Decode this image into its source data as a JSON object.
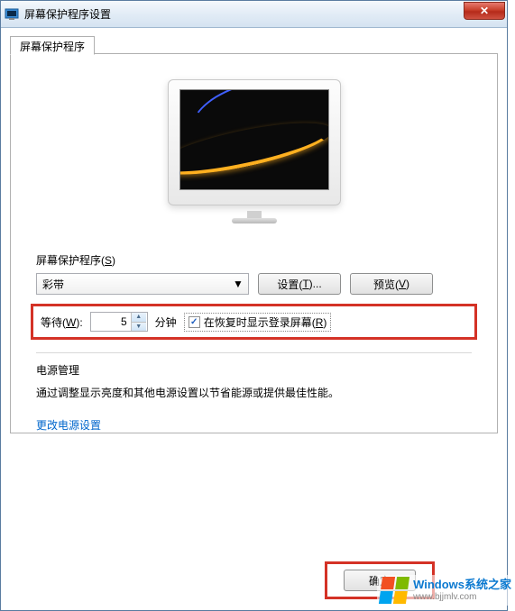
{
  "window": {
    "title": "屏幕保护程序设置",
    "close_label": "✕"
  },
  "tab": {
    "label": "屏幕保护程序"
  },
  "screensaver": {
    "section_title_pre": "屏幕保护程序(",
    "section_title_key": "S",
    "section_title_post": ")",
    "selected": "彩带",
    "settings_btn_pre": "设置(",
    "settings_btn_key": "T",
    "settings_btn_post": ")...",
    "preview_btn_pre": "预览(",
    "preview_btn_key": "V",
    "preview_btn_post": ")"
  },
  "wait": {
    "label_pre": "等待(",
    "label_key": "W",
    "label_post": "):",
    "value": "5",
    "unit": "分钟",
    "resume_pre": "在恢复时显示登录屏幕(",
    "resume_key": "R",
    "resume_post": ")",
    "checked": true
  },
  "power": {
    "title": "电源管理",
    "desc": "通过调整显示亮度和其他电源设置以节省能源或提供最佳性能。",
    "link": "更改电源设置"
  },
  "buttons": {
    "ok": "确定"
  },
  "watermark": {
    "top": "Windows系统之家",
    "bottom": "www.bjjmlv.com"
  }
}
